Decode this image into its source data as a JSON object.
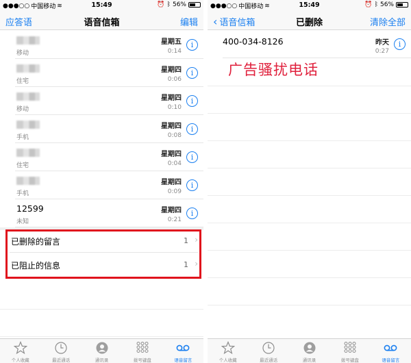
{
  "left": {
    "status": {
      "carrier": "中国移动",
      "time": "15:49",
      "battery": "56%",
      "battery_level": 0.56
    },
    "nav": {
      "left_label": "应答语",
      "title": "语音信箱",
      "right_label": "编辑"
    },
    "voicemails": [
      {
        "name": "",
        "type": "移动",
        "day": "星期五",
        "duration": "0:14"
      },
      {
        "name": "",
        "type": "住宅",
        "day": "星期四",
        "duration": "0:06"
      },
      {
        "name": "",
        "type": "移动",
        "day": "星期四",
        "duration": "0:10"
      },
      {
        "name": "",
        "type": "手机",
        "day": "星期四",
        "duration": "0:08"
      },
      {
        "name": "",
        "type": "住宅",
        "day": "星期四",
        "duration": "0:04"
      },
      {
        "name": "",
        "type": "手机",
        "day": "星期四",
        "duration": "0:09"
      },
      {
        "name": "12599",
        "type": "未知",
        "day": "星期四",
        "duration": "0:21"
      }
    ],
    "special": [
      {
        "label": "已删除的留言",
        "count": "1"
      },
      {
        "label": "已阻止的信息",
        "count": "1"
      }
    ]
  },
  "right": {
    "status": {
      "carrier": "中国移动",
      "time": "15:49",
      "battery": "56%",
      "battery_level": 0.56
    },
    "nav": {
      "back_label": "语音信箱",
      "title": "已删除",
      "right_label": "清除全部"
    },
    "deleted": {
      "number": "400-034-8126",
      "day": "昨天",
      "duration": "0:27"
    },
    "annotation": "广告骚扰电话"
  },
  "tabs": [
    {
      "label": "个人收藏",
      "icon": "star-icon"
    },
    {
      "label": "最近通话",
      "icon": "clock-icon"
    },
    {
      "label": "通讯录",
      "icon": "contacts-icon"
    },
    {
      "label": "拨号键盘",
      "icon": "keypad-icon"
    },
    {
      "label": "语音留言",
      "icon": "voicemail-icon",
      "active": true
    }
  ],
  "colors": {
    "accent": "#1a7ff0",
    "highlight_box": "#e0131d",
    "annotation": "#e0203c"
  }
}
